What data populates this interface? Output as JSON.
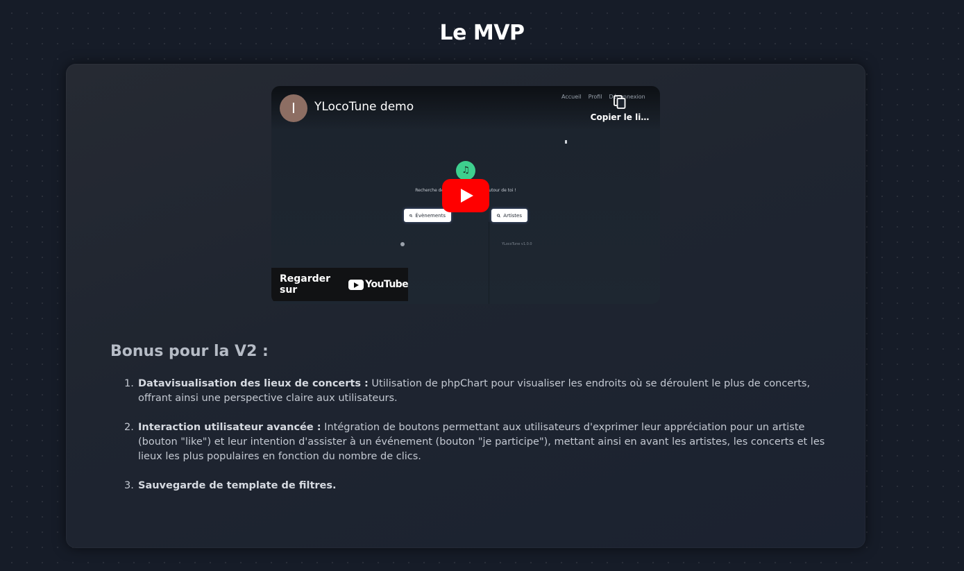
{
  "page": {
    "title": "Le MVP"
  },
  "video": {
    "channel_initial": "I",
    "title": "YLocoTune demo",
    "inner_nav": [
      "Accueil",
      "Profil",
      "Déconnexion"
    ],
    "copy_link_label": "Copier le li…",
    "app_logo_glyph": "♫",
    "app_tagline": "Recherche des artistes ... ements autour de toi !",
    "events_button": "Évènements",
    "artists_button": "Artistes",
    "version": "YLocoTune v1.0.0",
    "watch_on_label": "Regarder sur",
    "youtube_word": "YouTube",
    "colors": {
      "play": "#ff0000",
      "avatar": "#8d6e63",
      "logo": "#3ecf8e"
    }
  },
  "bonus": {
    "title": "Bonus pour la V2 :",
    "items": [
      {
        "num": "1.",
        "strong": "Datavisualisation des lieux de concerts :",
        "text": " Utilisation de phpChart pour visualiser les endroits où se déroulent le plus de concerts, offrant ainsi une perspective claire aux utilisateurs."
      },
      {
        "num": "2.",
        "strong": "Interaction utilisateur avancée :",
        "text": " Intégration de boutons permettant aux utilisateurs d'exprimer leur appréciation pour un artiste (bouton \"like\") et leur intention d'assister à un événement (bouton \"je participe\"), mettant ainsi en avant les artistes, les concerts et les lieux les plus populaires en fonction du nombre de clics."
      },
      {
        "num": "3.",
        "strong": "Sauvegarde de template de filtres.",
        "text": ""
      }
    ]
  }
}
